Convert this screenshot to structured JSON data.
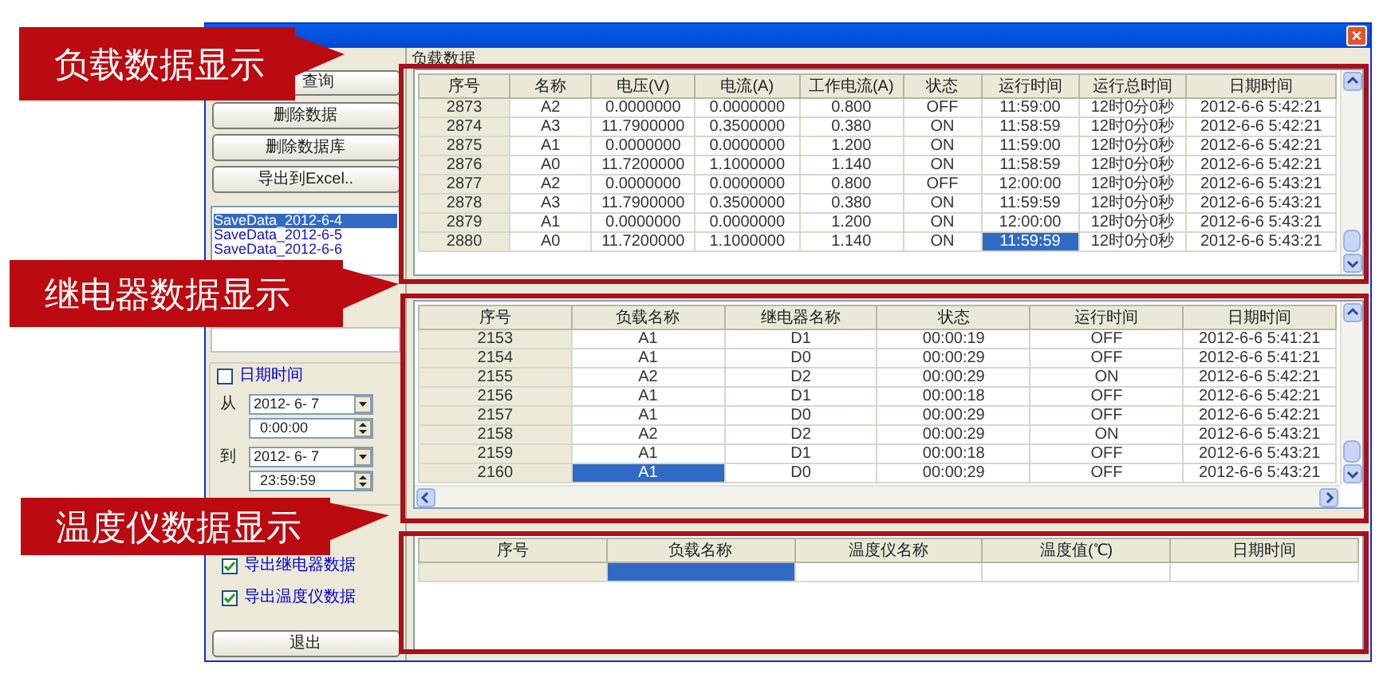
{
  "window": {
    "close": "×"
  },
  "sidebar": {
    "buttons": [
      "查询",
      "删除数据",
      "删除数据库",
      "导出到Excel.."
    ],
    "files": [
      {
        "label": "SaveData_2012-6-4",
        "selected": true
      },
      {
        "label": "SaveData_2012-6-5",
        "selected": false
      },
      {
        "label": "SaveData_2012-6-6",
        "selected": false
      }
    ],
    "date_filter": {
      "label": "日期时间",
      "checked": false,
      "from": {
        "label": "从",
        "date": "2012- 6- 7",
        "time": "0:00:00"
      },
      "to": {
        "label": "到",
        "date": "2012- 6- 7",
        "time": "23:59:59"
      }
    },
    "exports": [
      {
        "label": "导出继电器数据",
        "checked": true
      },
      {
        "label": "导出温度仪数据",
        "checked": true
      }
    ],
    "exit": "退出"
  },
  "load": {
    "title": "负载数据",
    "columns": [
      "序号",
      "名称",
      "电压(V)",
      "电流(A)",
      "工作电流(A)",
      "状态",
      "运行时间",
      "运行总时间",
      "日期时间"
    ],
    "rows": [
      {
        "cells": [
          {
            "text": "2873",
            "selected": false
          },
          {
            "text": "A2",
            "selected": false
          },
          {
            "text": "0.0000000",
            "selected": false
          },
          {
            "text": "0.0000000",
            "selected": false
          },
          {
            "text": "0.800",
            "selected": false
          },
          {
            "text": "OFF",
            "selected": false
          },
          {
            "text": "11:59:00",
            "selected": false
          },
          {
            "text": "12时0分0秒",
            "selected": false
          },
          {
            "text": "2012-6-6 5:42:21",
            "selected": false
          }
        ]
      },
      {
        "cells": [
          {
            "text": "2874",
            "selected": false
          },
          {
            "text": "A3",
            "selected": false
          },
          {
            "text": "11.7900000",
            "selected": false
          },
          {
            "text": "0.3500000",
            "selected": false
          },
          {
            "text": "0.380",
            "selected": false
          },
          {
            "text": "ON",
            "selected": false
          },
          {
            "text": "11:58:59",
            "selected": false
          },
          {
            "text": "12时0分0秒",
            "selected": false
          },
          {
            "text": "2012-6-6 5:42:21",
            "selected": false
          }
        ]
      },
      {
        "cells": [
          {
            "text": "2875",
            "selected": false
          },
          {
            "text": "A1",
            "selected": false
          },
          {
            "text": "0.0000000",
            "selected": false
          },
          {
            "text": "0.0000000",
            "selected": false
          },
          {
            "text": "1.200",
            "selected": false
          },
          {
            "text": "ON",
            "selected": false
          },
          {
            "text": "11:59:00",
            "selected": false
          },
          {
            "text": "12时0分0秒",
            "selected": false
          },
          {
            "text": "2012-6-6 5:42:21",
            "selected": false
          }
        ]
      },
      {
        "cells": [
          {
            "text": "2876",
            "selected": false
          },
          {
            "text": "A0",
            "selected": false
          },
          {
            "text": "11.7200000",
            "selected": false
          },
          {
            "text": "1.1000000",
            "selected": false
          },
          {
            "text": "1.140",
            "selected": false
          },
          {
            "text": "ON",
            "selected": false
          },
          {
            "text": "11:58:59",
            "selected": false
          },
          {
            "text": "12时0分0秒",
            "selected": false
          },
          {
            "text": "2012-6-6 5:42:21",
            "selected": false
          }
        ]
      },
      {
        "cells": [
          {
            "text": "2877",
            "selected": false
          },
          {
            "text": "A2",
            "selected": false
          },
          {
            "text": "0.0000000",
            "selected": false
          },
          {
            "text": "0.0000000",
            "selected": false
          },
          {
            "text": "0.800",
            "selected": false
          },
          {
            "text": "OFF",
            "selected": false
          },
          {
            "text": "12:00:00",
            "selected": false
          },
          {
            "text": "12时0分0秒",
            "selected": false
          },
          {
            "text": "2012-6-6 5:43:21",
            "selected": false
          }
        ]
      },
      {
        "cells": [
          {
            "text": "2878",
            "selected": false
          },
          {
            "text": "A3",
            "selected": false
          },
          {
            "text": "11.7900000",
            "selected": false
          },
          {
            "text": "0.3500000",
            "selected": false
          },
          {
            "text": "0.380",
            "selected": false
          },
          {
            "text": "ON",
            "selected": false
          },
          {
            "text": "11:59:59",
            "selected": false
          },
          {
            "text": "12时0分0秒",
            "selected": false
          },
          {
            "text": "2012-6-6 5:43:21",
            "selected": false
          }
        ]
      },
      {
        "cells": [
          {
            "text": "2879",
            "selected": false
          },
          {
            "text": "A1",
            "selected": false
          },
          {
            "text": "0.0000000",
            "selected": false
          },
          {
            "text": "0.0000000",
            "selected": false
          },
          {
            "text": "1.200",
            "selected": false
          },
          {
            "text": "ON",
            "selected": false
          },
          {
            "text": "12:00:00",
            "selected": false
          },
          {
            "text": "12时0分0秒",
            "selected": false
          },
          {
            "text": "2012-6-6 5:43:21",
            "selected": false
          }
        ]
      },
      {
        "cells": [
          {
            "text": "2880",
            "selected": false
          },
          {
            "text": "A0",
            "selected": false
          },
          {
            "text": "11.7200000",
            "selected": false
          },
          {
            "text": "1.1000000",
            "selected": false
          },
          {
            "text": "1.140",
            "selected": false
          },
          {
            "text": "ON",
            "selected": false
          },
          {
            "text": "11:59:59",
            "selected": true
          },
          {
            "text": "12时0分0秒",
            "selected": false
          },
          {
            "text": "2012-6-6 5:43:21",
            "selected": false
          }
        ]
      }
    ]
  },
  "relay": {
    "columns": [
      "序号",
      "负载名称",
      "继电器名称",
      "状态",
      "运行时间",
      "日期时间"
    ],
    "rows": [
      {
        "cells": [
          {
            "text": "2153",
            "selected": false
          },
          {
            "text": "A1",
            "selected": false
          },
          {
            "text": "D1",
            "selected": false
          },
          {
            "text": "00:00:19",
            "selected": false
          },
          {
            "text": "OFF",
            "selected": false
          },
          {
            "text": "2012-6-6 5:41:21",
            "selected": false
          }
        ]
      },
      {
        "cells": [
          {
            "text": "2154",
            "selected": false
          },
          {
            "text": "A1",
            "selected": false
          },
          {
            "text": "D0",
            "selected": false
          },
          {
            "text": "00:00:29",
            "selected": false
          },
          {
            "text": "OFF",
            "selected": false
          },
          {
            "text": "2012-6-6 5:41:21",
            "selected": false
          }
        ]
      },
      {
        "cells": [
          {
            "text": "2155",
            "selected": false
          },
          {
            "text": "A2",
            "selected": false
          },
          {
            "text": "D2",
            "selected": false
          },
          {
            "text": "00:00:29",
            "selected": false
          },
          {
            "text": "ON",
            "selected": false
          },
          {
            "text": "2012-6-6 5:42:21",
            "selected": false
          }
        ]
      },
      {
        "cells": [
          {
            "text": "2156",
            "selected": false
          },
          {
            "text": "A1",
            "selected": false
          },
          {
            "text": "D1",
            "selected": false
          },
          {
            "text": "00:00:18",
            "selected": false
          },
          {
            "text": "OFF",
            "selected": false
          },
          {
            "text": "2012-6-6 5:42:21",
            "selected": false
          }
        ]
      },
      {
        "cells": [
          {
            "text": "2157",
            "selected": false
          },
          {
            "text": "A1",
            "selected": false
          },
          {
            "text": "D0",
            "selected": false
          },
          {
            "text": "00:00:29",
            "selected": false
          },
          {
            "text": "OFF",
            "selected": false
          },
          {
            "text": "2012-6-6 5:42:21",
            "selected": false
          }
        ]
      },
      {
        "cells": [
          {
            "text": "2158",
            "selected": false
          },
          {
            "text": "A2",
            "selected": false
          },
          {
            "text": "D2",
            "selected": false
          },
          {
            "text": "00:00:29",
            "selected": false
          },
          {
            "text": "ON",
            "selected": false
          },
          {
            "text": "2012-6-6 5:43:21",
            "selected": false
          }
        ]
      },
      {
        "cells": [
          {
            "text": "2159",
            "selected": false
          },
          {
            "text": "A1",
            "selected": false
          },
          {
            "text": "D1",
            "selected": false
          },
          {
            "text": "00:00:18",
            "selected": false
          },
          {
            "text": "OFF",
            "selected": false
          },
          {
            "text": "2012-6-6 5:43:21",
            "selected": false
          }
        ]
      },
      {
        "cells": [
          {
            "text": "2160",
            "selected": false
          },
          {
            "text": "A1",
            "selected": true
          },
          {
            "text": "D0",
            "selected": false
          },
          {
            "text": "00:00:29",
            "selected": false
          },
          {
            "text": "OFF",
            "selected": false
          },
          {
            "text": "2012-6-6 5:43:21",
            "selected": false
          }
        ]
      }
    ]
  },
  "temperature": {
    "columns": [
      "序号",
      "负载名称",
      "温度仪名称",
      "温度值(℃)",
      "日期时间"
    ],
    "rows": [
      {
        "cells": [
          {
            "selected": false
          },
          {
            "selected": true
          },
          {
            "selected": false
          },
          {
            "selected": false
          },
          {
            "selected": false
          }
        ]
      }
    ]
  },
  "annotations": [
    {
      "text": "负载数据显示"
    },
    {
      "text": "继电器数据显示"
    },
    {
      "text": "温度仪数据显示"
    }
  ]
}
